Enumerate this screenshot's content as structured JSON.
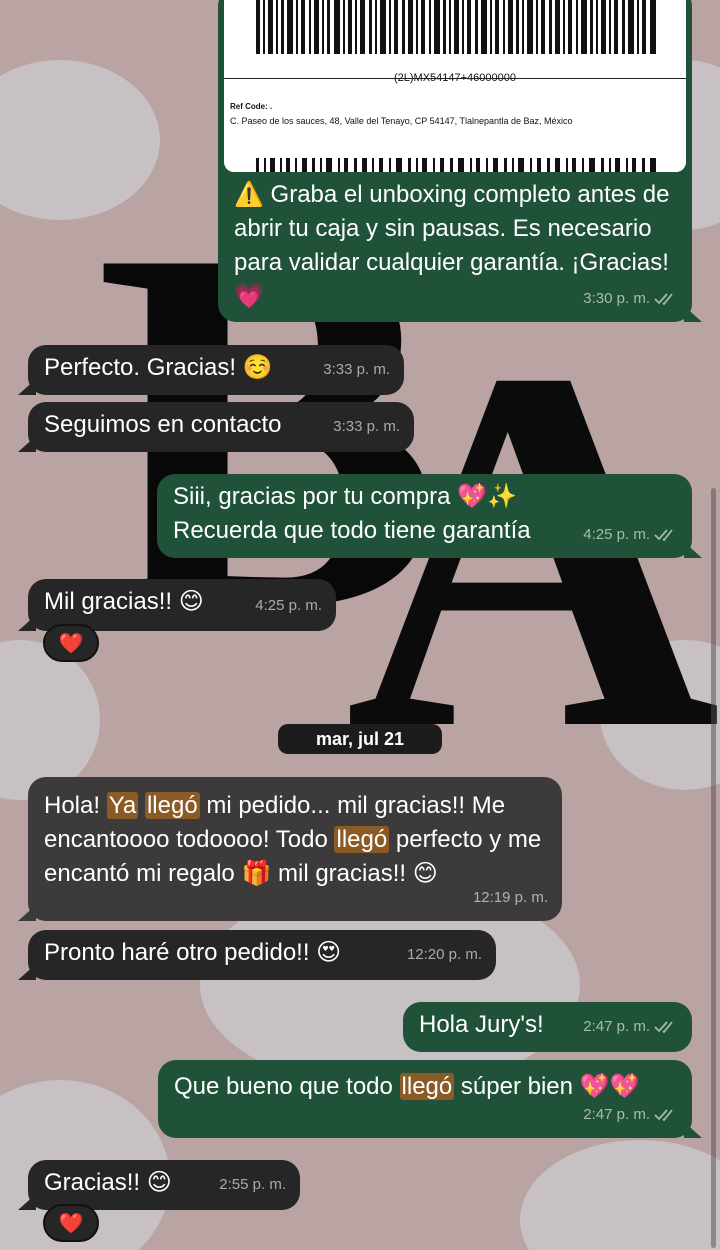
{
  "colors": {
    "wallpaper": "#b9a3a3",
    "incoming_bubble": "#262626",
    "outgoing_bubble": "#1f5238",
    "highlight": "#8a5b24"
  },
  "shipping_label": {
    "tracking": "(2L)MX54147+46000000",
    "ref_code": "Ref Code: .",
    "address": "C. Paseo de los sauces, 48, Valle del Tenayo, CP 54147, Tlalnepantla de Baz, México"
  },
  "messages": [
    {
      "dir": "out",
      "text": "⚠️ Graba el unboxing completo antes de abrir tu caja y sin pausas. Es necesario para validar cualquier garantía. ¡Gracias! 💗",
      "time": "3:30 p. m."
    },
    {
      "dir": "in",
      "text": "Perfecto. Gracias! ☺️",
      "time": "3:33 p. m."
    },
    {
      "dir": "in",
      "text": "Seguimos en contacto",
      "time": "3:33 p. m."
    },
    {
      "dir": "out",
      "line1": "Siii, gracias por tu compra 💖✨",
      "line2": "Recuerda que todo tiene garantía",
      "time": "4:25 p. m."
    },
    {
      "dir": "in",
      "text": "Mil gracias!! 😊",
      "time": "4:25 p. m.",
      "reaction": "❤️"
    },
    {
      "dir": "in",
      "time": "12:19 p. m.",
      "p1": "Hola! ",
      "h1": "Ya",
      "p2": " ",
      "h2": "llegó",
      "p3": " mi pedido... mil gracias!! Me encantoooo todoooo! Todo ",
      "h3": "llegó",
      "p4": " perfecto y me encantó mi regalo 🎁 mil gracias!! 😊"
    },
    {
      "dir": "in",
      "text": "Pronto haré otro pedido!! 😍",
      "time": "12:20 p. m."
    },
    {
      "dir": "out",
      "text": "Hola Jury's!",
      "time": "2:47 p. m."
    },
    {
      "dir": "out",
      "pre": "Que bueno que todo ",
      "hl": "llegó",
      "post": " súper bien 💖💖",
      "time": "2:47 p. m."
    },
    {
      "dir": "in",
      "text": "Gracias!! 😊",
      "time": "2:55 p. m.",
      "reaction": "❤️"
    }
  ],
  "date_separator": "mar, jul 21",
  "icons": {
    "read_receipt": "double-check-icon",
    "reaction_heart": "heart-icon"
  }
}
